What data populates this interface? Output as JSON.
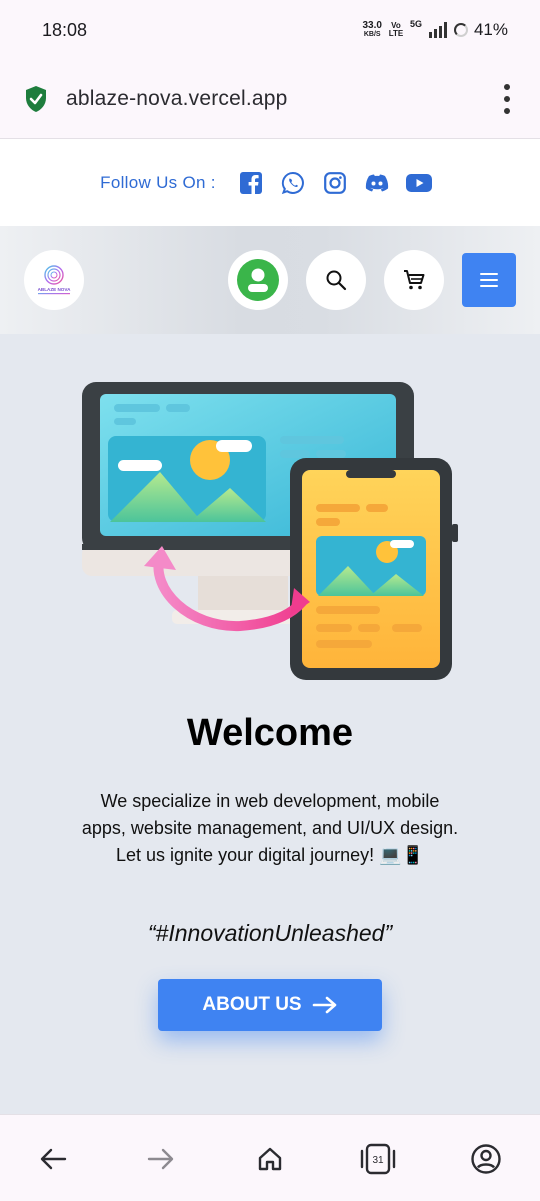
{
  "status_bar": {
    "time": "18:08",
    "net_speed_value": "33.0",
    "net_speed_unit": "KB/S",
    "volte": "Vo LTE",
    "network": "5G",
    "battery": "41%"
  },
  "browser": {
    "url": "ablaze-nova.vercel.app",
    "secure_icon": "shield-check-icon",
    "menu_icon": "more-vertical-icon"
  },
  "follow_bar": {
    "label": "Follow Us On :",
    "icons": [
      "facebook-icon",
      "whatsapp-icon",
      "instagram-icon",
      "discord-icon",
      "youtube-icon"
    ],
    "color": "#2f6bd4"
  },
  "header": {
    "logo_text": "ABLAZE NOVA",
    "icons": [
      "profile-icon",
      "search-icon",
      "cart-icon",
      "menu-icon"
    ],
    "accent": "#3f83f2",
    "profile_color": "#3ab54a"
  },
  "hero": {
    "title": "Welcome",
    "description": "We specialize in web development, mobile apps, website management, and UI/UX design. Let us ignite your digital journey! 💻📱",
    "tagline": "“#InnovationUnleashed”",
    "cta_label": "ABOUT US",
    "cta_icon": "arrow-right-icon"
  },
  "bottom_nav": {
    "items": [
      "back-icon",
      "forward-icon",
      "home-icon",
      "tabs-icon",
      "account-icon"
    ],
    "tab_count": "31"
  }
}
